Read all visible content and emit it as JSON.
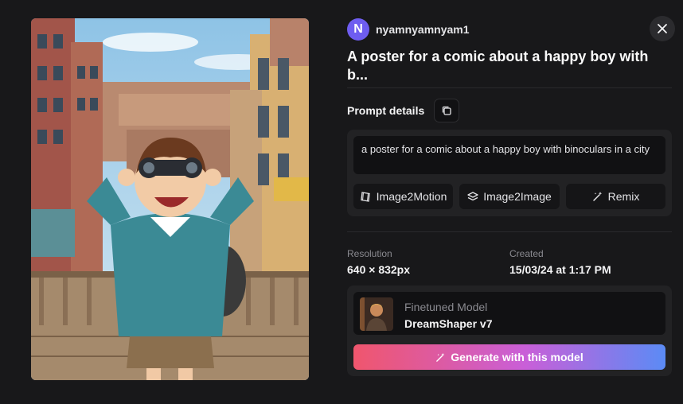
{
  "author": {
    "initial": "N",
    "name": "nyamnyamnyam1"
  },
  "title": "A poster for a comic about a happy boy with b...",
  "prompt": {
    "label": "Prompt details",
    "text": "a poster for a comic about a happy boy with binoculars in a city",
    "actions": [
      {
        "label": "Image2Motion",
        "icon": "film-icon"
      },
      {
        "label": "Image2Image",
        "icon": "layers-icon"
      },
      {
        "label": "Remix",
        "icon": "magic-wand-icon"
      }
    ]
  },
  "details": {
    "resolution_label": "Resolution",
    "resolution_value": "640 × 832px",
    "created_label": "Created",
    "created_value": "15/03/24 at 1:17 PM"
  },
  "model": {
    "type_label": "Finetuned Model",
    "name": "DreamShaper v7",
    "generate_label": "Generate with this model"
  },
  "colors": {
    "background": "#18181a",
    "card": "#222224",
    "avatar": "#6e5df0",
    "gradient_start": "#f0566d",
    "gradient_end": "#5b8bf5"
  }
}
